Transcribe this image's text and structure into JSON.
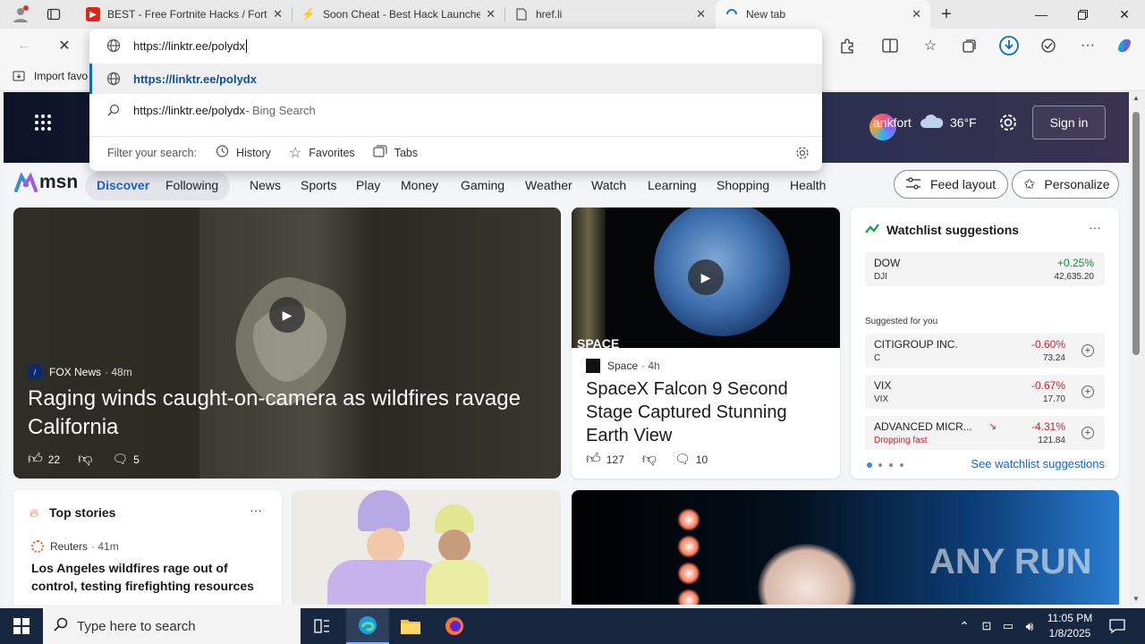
{
  "tabs": [
    {
      "title": "BEST - Free Fortnite Hacks / Fortn",
      "icon": "youtube-icon",
      "color": "#e62117"
    },
    {
      "title": "Soon Cheat - Best Hack Launche",
      "icon": "lightning-icon",
      "color": "#d9682b"
    },
    {
      "title": "href.li",
      "icon": "page-icon",
      "color": "#666666"
    },
    {
      "title": "New tab",
      "icon": "loading-icon",
      "color": "#1a73e8"
    }
  ],
  "omnibox": {
    "value": "https://linktr.ee/polydx",
    "suggestions": [
      {
        "text": "https://linktr.ee/polydx",
        "suffix": ""
      },
      {
        "text": "https://linktr.ee/polydx",
        "suffix": " - Bing Search"
      }
    ],
    "filter_label": "Filter your search:",
    "filters": [
      "History",
      "Favorites",
      "Tabs"
    ]
  },
  "favorites_bar": {
    "import_label": "Import favo"
  },
  "hero": {
    "location": "ankfort",
    "temp": "36°F",
    "signin": "Sign in"
  },
  "msn": {
    "logo": "msn",
    "tabs_active": "Discover",
    "tabs": [
      "Discover",
      "Following"
    ],
    "nav": [
      "News",
      "Sports",
      "Play",
      "Money",
      "Gaming",
      "Weather",
      "Watch",
      "Learning",
      "Shopping",
      "Health"
    ],
    "feed_layout": "Feed layout",
    "personalize": "Personalize"
  },
  "main_story": {
    "source": "FOX News",
    "age": "· 48m",
    "title": "Raging winds caught-on-camera as wildfires ravage California",
    "likes": "22",
    "comments": "5"
  },
  "space_story": {
    "source": "Space",
    "age": "· 4h",
    "title": "SpaceX Falcon 9 Second Stage Captured Stunning Earth View",
    "likes": "127",
    "comments": "10",
    "overlay": "SPACE"
  },
  "watchlist": {
    "title": "Watchlist suggestions",
    "top": {
      "name": "DOW",
      "sym": "DJI",
      "chg": "+0.25%",
      "price": "42,635.20"
    },
    "suggested_label": "Suggested for you",
    "items": [
      {
        "name": "CITIGROUP INC.",
        "sym": "C",
        "chg": "-0.60%",
        "price": "73.24"
      },
      {
        "name": "VIX",
        "sym": "VIX",
        "chg": "-0.67%",
        "price": "17.70"
      },
      {
        "name": "ADVANCED MICR...",
        "sym": "Dropping fast",
        "chg": "-4.31%",
        "price": "121.84"
      }
    ],
    "see_more": "See watchlist suggestions",
    "colors": {
      "up": "#138a36",
      "down": "#c4262e"
    }
  },
  "top_stories": {
    "title": "Top stories",
    "source": "Reuters",
    "age": "· 41m",
    "headline": "Los Angeles wildfires rage out of control, testing firefighting resources"
  },
  "watermark": "ANY RUN",
  "taskbar": {
    "search_placeholder": "Type here to search",
    "time": "11:05 PM",
    "date": "1/8/2025"
  }
}
